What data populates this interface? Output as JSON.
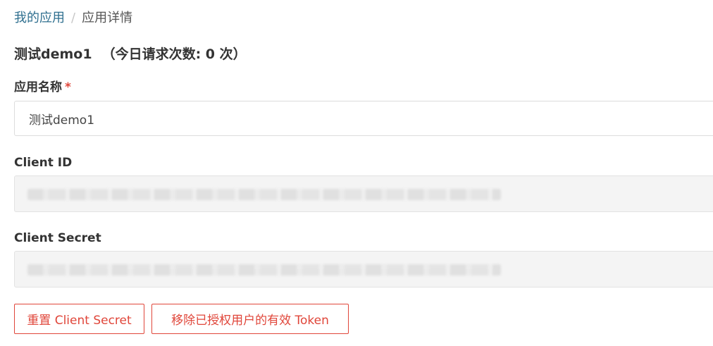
{
  "breadcrumb": {
    "parent": "我的应用",
    "separator": "/",
    "current": "应用详情"
  },
  "page": {
    "title": "测试demo1",
    "request_count": "（今日请求次数: 0 次）"
  },
  "form": {
    "app_name": {
      "label": "应用名称",
      "required_mark": "*",
      "value": "测试demo1"
    },
    "client_id": {
      "label": "Client ID"
    },
    "client_secret": {
      "label": "Client Secret"
    }
  },
  "actions": {
    "reset_secret": "重置 Client Secret",
    "revoke_tokens": "移除已授权用户的有效 Token"
  },
  "colors": {
    "link": "#2f6f8f",
    "danger": "#e0463a",
    "readonly_bg": "#f4f4f4"
  }
}
